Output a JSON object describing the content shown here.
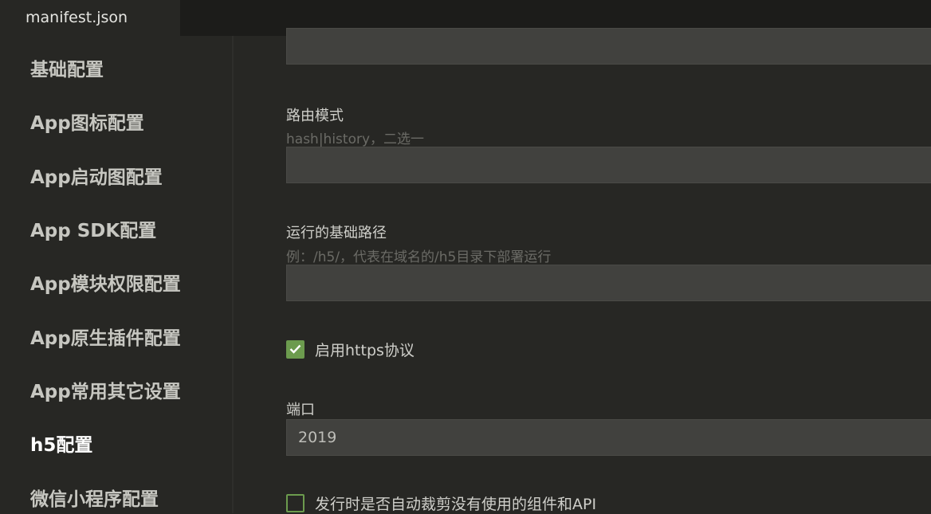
{
  "tabs": [
    {
      "label": "manifest.json"
    }
  ],
  "sidebar": {
    "items": [
      {
        "label": "基础配置"
      },
      {
        "label": "App图标配置"
      },
      {
        "label": "App启动图配置"
      },
      {
        "label": "App SDK配置"
      },
      {
        "label": "App模块权限配置"
      },
      {
        "label": "App原生插件配置"
      },
      {
        "label": "App常用其它设置"
      },
      {
        "label": "h5配置",
        "active": true
      },
      {
        "label": "微信小程序配置"
      }
    ]
  },
  "form": {
    "top_input": {
      "value": ""
    },
    "router_mode": {
      "label": "路由模式",
      "hint": "hash|history，二选一",
      "value": ""
    },
    "base_path": {
      "label": "运行的基础路径",
      "hint": "例：/h5/，代表在域名的/h5目录下部署运行",
      "value": ""
    },
    "https": {
      "label": "启用https协议",
      "checked": true
    },
    "port": {
      "label": "端口",
      "value": "2019"
    },
    "treeshake": {
      "label": "发行时是否自动裁剪没有使用的组件和API",
      "checked": false
    }
  },
  "colors": {
    "accent_green": "#6c9b4e",
    "background": "#272724",
    "input_bg": "#41413e"
  }
}
